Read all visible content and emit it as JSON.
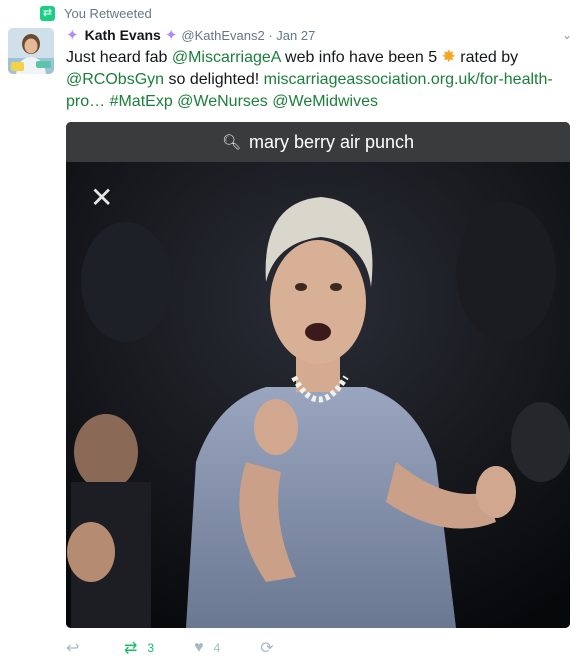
{
  "retweet_context": {
    "label": "You Retweeted"
  },
  "tweet": {
    "fullname": "Kath Evans",
    "handle": "@KathEvans2",
    "date": "Jan 27",
    "text_parts": {
      "p1": "Just heard fab ",
      "mention1": "@MiscarriageA",
      "p2": " web info have been 5 ",
      "p3": " rated by",
      "mention2": "@RCObsGyn",
      "p4": "  so delighted! ",
      "url": "miscarriageassociation.org.uk/for-health-pro…",
      "hashtag": "#MatExp",
      "mention3": "@WeNurses",
      "mention4": "@WeMidwives"
    },
    "media": {
      "search_text": "mary berry air punch"
    },
    "actions": {
      "retweet_count": "3",
      "like_count": "4"
    }
  },
  "colors": {
    "link": "#1b7f3a",
    "retweet_green": "#19cf86",
    "muted": "#657786"
  },
  "icons": [
    "retweet-icon",
    "sparkle-icon",
    "star-emoji-icon",
    "search-icon",
    "close-icon",
    "reply-icon",
    "heart-icon",
    "more-icon"
  ]
}
